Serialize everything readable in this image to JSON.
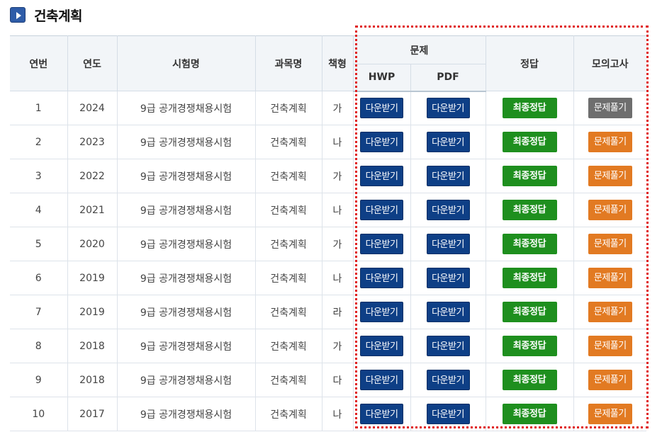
{
  "page": {
    "title": "건축계획"
  },
  "table": {
    "headers": {
      "no": "연번",
      "year": "연도",
      "exam": "시험명",
      "subject": "과목명",
      "booklet": "책형",
      "problem": "문제",
      "hwp": "HWP",
      "pdf": "PDF",
      "answer": "정답",
      "mock": "모의고사"
    },
    "download_label": "다운받기",
    "answer_label": "최종정답",
    "solve_label": "문제풀기",
    "rows": [
      {
        "no": "1",
        "year": "2024",
        "exam": "9급 공개경쟁채용시험",
        "subject": "건축계획",
        "booklet": "가"
      },
      {
        "no": "2",
        "year": "2023",
        "exam": "9급 공개경쟁채용시험",
        "subject": "건축계획",
        "booklet": "나"
      },
      {
        "no": "3",
        "year": "2022",
        "exam": "9급 공개경쟁채용시험",
        "subject": "건축계획",
        "booklet": "가"
      },
      {
        "no": "4",
        "year": "2021",
        "exam": "9급 공개경쟁채용시험",
        "subject": "건축계획",
        "booklet": "나"
      },
      {
        "no": "5",
        "year": "2020",
        "exam": "9급 공개경쟁채용시험",
        "subject": "건축계획",
        "booklet": "가"
      },
      {
        "no": "6",
        "year": "2019",
        "exam": "9급 공개경쟁채용시험",
        "subject": "건축계획",
        "booklet": "나"
      },
      {
        "no": "7",
        "year": "2019",
        "exam": "9급 공개경쟁채용시험",
        "subject": "건축계획",
        "booklet": "라"
      },
      {
        "no": "8",
        "year": "2018",
        "exam": "9급 공개경쟁채용시험",
        "subject": "건축계획",
        "booklet": "가"
      },
      {
        "no": "9",
        "year": "2018",
        "exam": "9급 공개경쟁채용시험",
        "subject": "건축계획",
        "booklet": "다"
      },
      {
        "no": "10",
        "year": "2017",
        "exam": "9급 공개경쟁채용시험",
        "subject": "건축계획",
        "booklet": "나"
      }
    ]
  },
  "colors": {
    "download": "#0e3f86",
    "answer": "#1e8f1e",
    "solve": "#e27a22",
    "solve_first": "#6e6e6e",
    "highlight": "#e02020"
  }
}
